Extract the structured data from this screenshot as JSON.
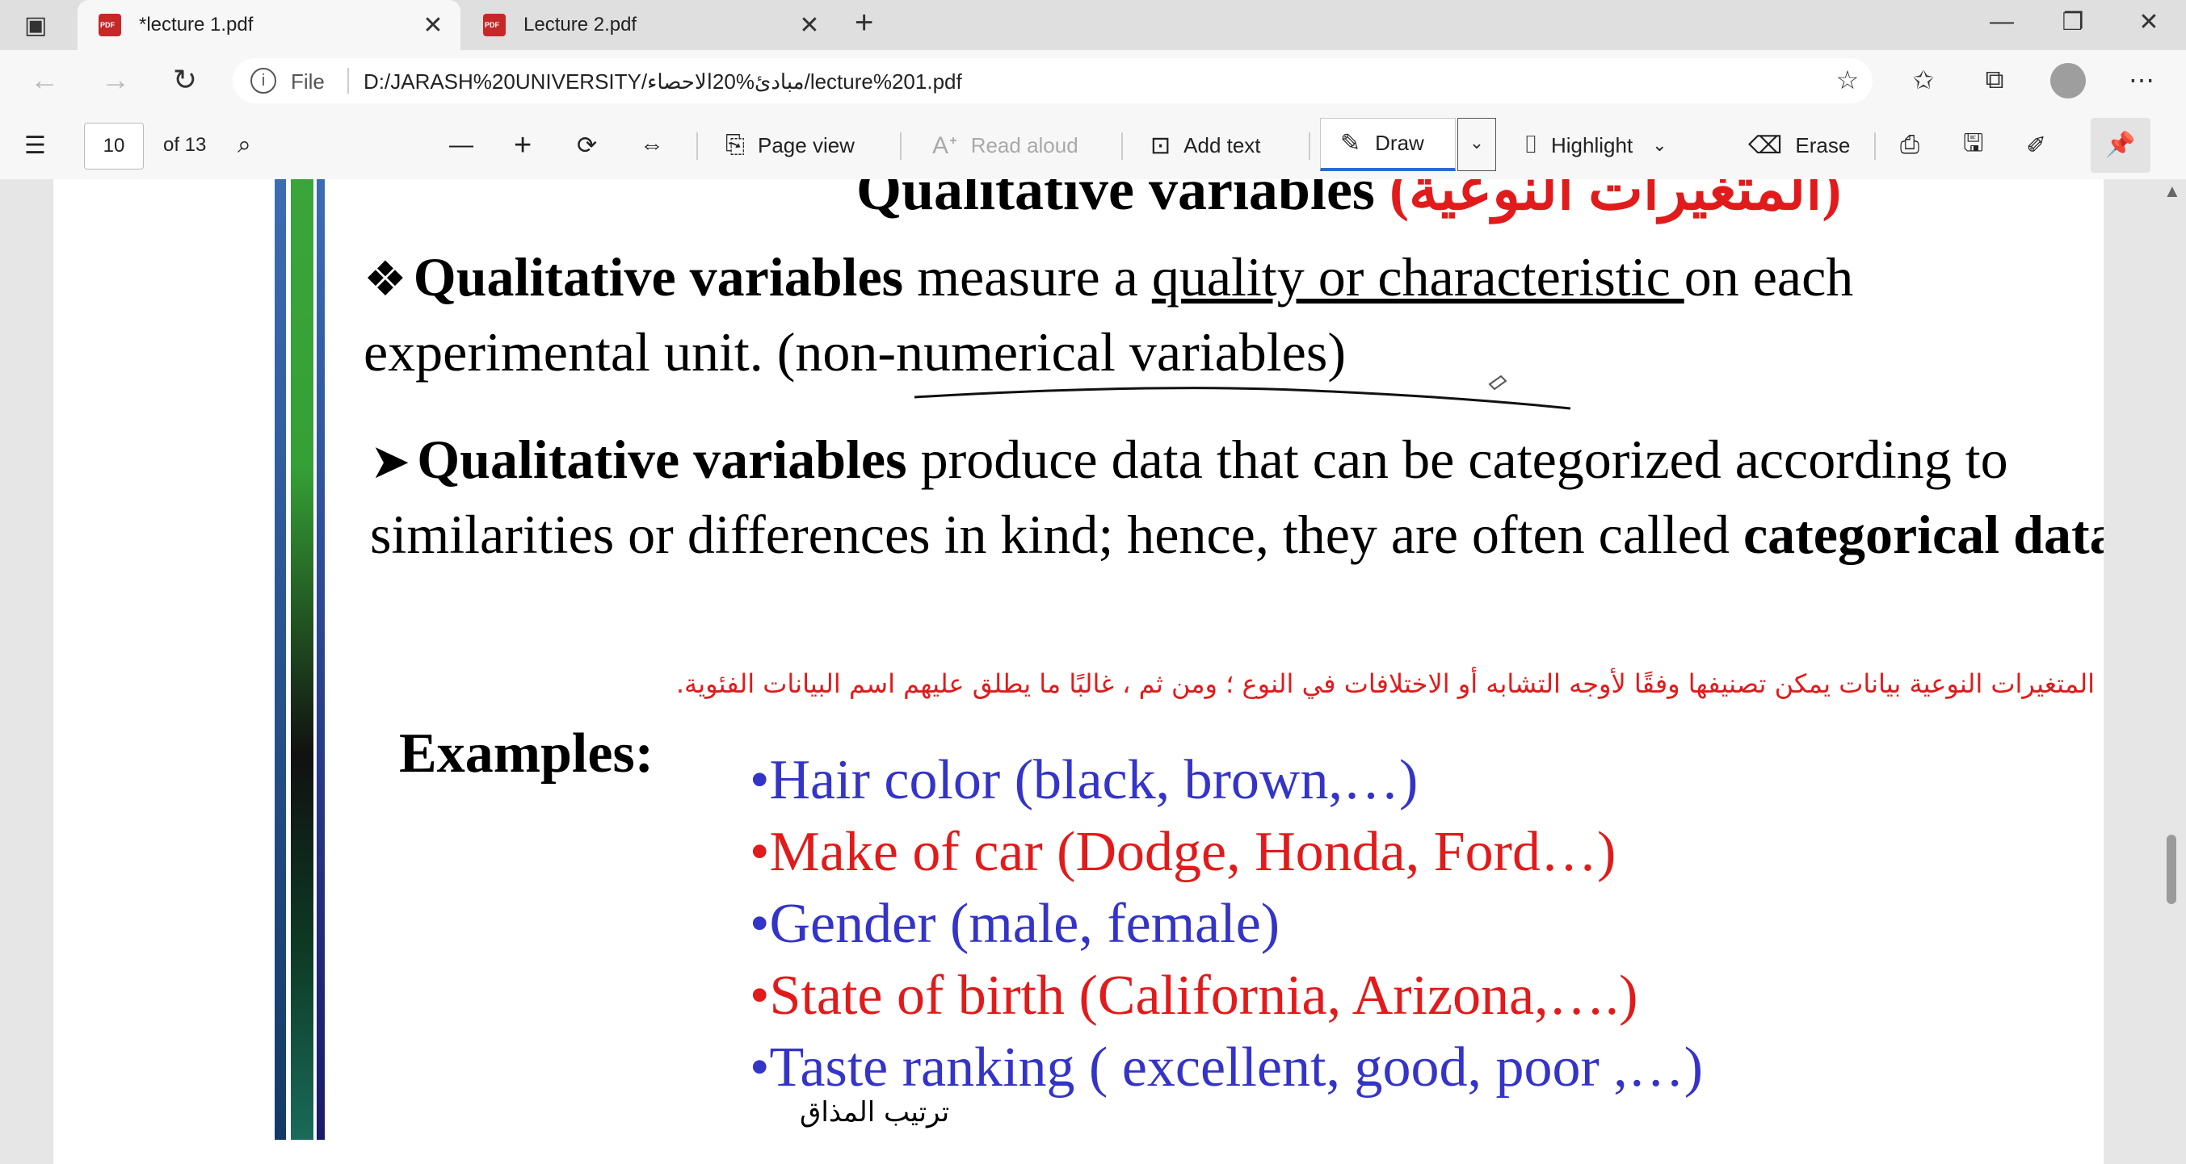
{
  "browser": {
    "tabs": [
      {
        "title": "*lecture 1.pdf",
        "active": true
      },
      {
        "title": "Lecture 2.pdf",
        "active": false
      }
    ],
    "new_tab": "+",
    "close_glyph": "✕"
  },
  "address": {
    "info": "i",
    "file_label": "File",
    "url": "D:/JARASH%20UNIVERSITY/مبادئ%20الاحصاء/lecture%201.pdf"
  },
  "pdf_toolbar": {
    "page_number": "10",
    "page_total": "of 13",
    "page_view": "Page view",
    "read_aloud": "Read aloud",
    "add_text": "Add text",
    "draw": "Draw",
    "highlight": "Highlight",
    "erase": "Erase"
  },
  "slide": {
    "title_en": "Qualitative variables ",
    "title_ar": "(المتغيرات النوعية)",
    "p1": {
      "bullet": "❖",
      "bold": "Qualitative variables",
      "text1": " measure a ",
      "underlined": "quality or characteristic ",
      "text2": "on each experimental unit.    ",
      "paren": "(non-numerical variables)"
    },
    "p2": {
      "bullet": "➤",
      "bold": "Qualitative variables",
      "text": " produce data that can be categorized according to similarities or differences in kind; hence, they are often called ",
      "bold2": "categorical data",
      "end": "."
    },
    "arabic_note": "تنتج المتغيرات النوعية بيانات يمكن تصنيفها وفقًا لأوجه التشابه أو الاختلافات في النوع ؛ ومن ثم ، غالبًا ما يطلق عليهم اسم البيانات الفئوية.",
    "examples_label": "Examples:",
    "examples": [
      "•Hair color (black, brown,…)",
      "•Make of car (Dodge, Honda, Ford…)",
      "•Gender (male, female)",
      "•State of birth (California, Arizona,….)",
      "•Taste ranking ( excellent, good, poor ,…)"
    ],
    "arabic_small": "ترتيب      المذاق",
    "colors": {
      "blue": "#3434c8",
      "red": "#e11b1b",
      "accent": "#2f6ad0"
    }
  }
}
